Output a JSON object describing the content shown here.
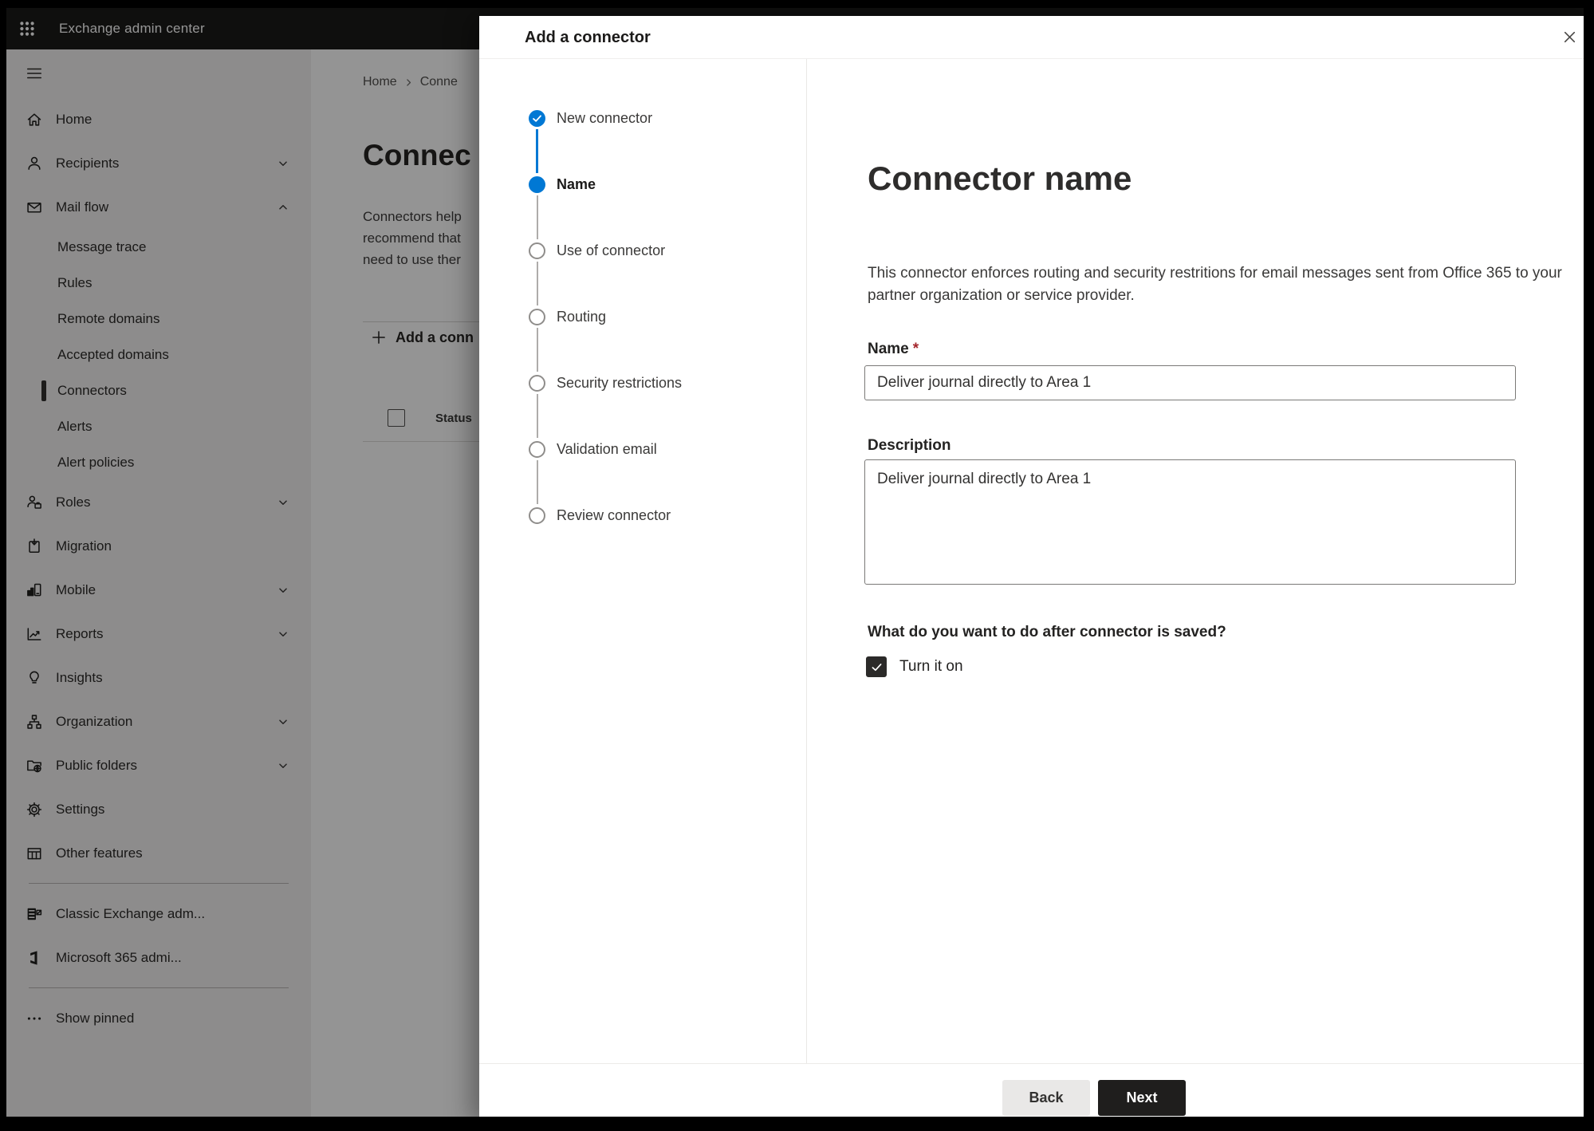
{
  "colors": {
    "accent": "#0078d4",
    "primary_button": "#1f1e1d",
    "required_marker": "#a4262c",
    "selected_indicator": "#323130"
  },
  "topbar": {
    "title": "Exchange admin center"
  },
  "sidebar": {
    "items": [
      {
        "id": "home",
        "label": "Home",
        "icon": "home-icon"
      },
      {
        "id": "recipients",
        "label": "Recipients",
        "icon": "person-icon",
        "chevron": "down"
      },
      {
        "id": "mail-flow",
        "label": "Mail flow",
        "icon": "mail-icon",
        "chevron": "up"
      },
      {
        "id": "message-trace",
        "label": "Message trace",
        "sub": true
      },
      {
        "id": "rules",
        "label": "Rules",
        "sub": true
      },
      {
        "id": "remote-domains",
        "label": "Remote domains",
        "sub": true
      },
      {
        "id": "accepted-domains",
        "label": "Accepted domains",
        "sub": true
      },
      {
        "id": "connectors",
        "label": "Connectors",
        "sub": true,
        "selected": true
      },
      {
        "id": "alerts",
        "label": "Alerts",
        "sub": true
      },
      {
        "id": "alert-policies",
        "label": "Alert policies",
        "sub": true
      },
      {
        "id": "roles",
        "label": "Roles",
        "icon": "roles-icon",
        "chevron": "down"
      },
      {
        "id": "migration",
        "label": "Migration",
        "icon": "migration-icon"
      },
      {
        "id": "mobile",
        "label": "Mobile",
        "icon": "mobile-icon",
        "chevron": "down"
      },
      {
        "id": "reports",
        "label": "Reports",
        "icon": "reports-icon",
        "chevron": "down"
      },
      {
        "id": "insights",
        "label": "Insights",
        "icon": "insights-icon"
      },
      {
        "id": "organization",
        "label": "Organization",
        "icon": "organization-icon",
        "chevron": "down"
      },
      {
        "id": "public-folders",
        "label": "Public folders",
        "icon": "public-folders-icon",
        "chevron": "down"
      },
      {
        "id": "settings",
        "label": "Settings",
        "icon": "settings-icon"
      },
      {
        "id": "other-features",
        "label": "Other features",
        "icon": "other-features-icon"
      },
      {
        "divider": true
      },
      {
        "id": "classic-exchange",
        "label": "Classic Exchange adm...",
        "icon": "classic-exchange-icon"
      },
      {
        "id": "m365-admin",
        "label": "Microsoft 365 admi...",
        "icon": "m365-icon"
      },
      {
        "divider": true
      },
      {
        "id": "show-pinned",
        "label": "Show pinned",
        "icon": "more-icon"
      }
    ]
  },
  "page": {
    "breadcrumb": {
      "home": "Home",
      "current": "Conne"
    },
    "heading": "Connec",
    "intro_lines": [
      "Connectors help",
      "recommend that",
      "need to use ther"
    ],
    "add_button_label": "Add a conn",
    "table": {
      "status_header": "Status"
    }
  },
  "modal": {
    "title": "Add a connector",
    "steps": [
      {
        "label": "New connector",
        "state": "complete"
      },
      {
        "label": "Name",
        "state": "current"
      },
      {
        "label": "Use of connector",
        "state": "upcoming"
      },
      {
        "label": "Routing",
        "state": "upcoming"
      },
      {
        "label": "Security restrictions",
        "state": "upcoming"
      },
      {
        "label": "Validation email",
        "state": "upcoming"
      },
      {
        "label": "Review connector",
        "state": "upcoming"
      }
    ],
    "content": {
      "heading": "Connector name",
      "description": "This connector enforces routing and security restritions for email messages sent from Office 365 to your partner organization or service provider.",
      "name_label": "Name",
      "required_marker": "*",
      "name_value": "Deliver journal directly to Area 1",
      "description_label": "Description",
      "description_value": "Deliver journal directly to Area 1",
      "after_save_question": "What do you want to do after connector is saved?",
      "turn_on_label": "Turn it on",
      "turn_on_checked": true
    },
    "footer": {
      "back_label": "Back",
      "next_label": "Next"
    }
  }
}
